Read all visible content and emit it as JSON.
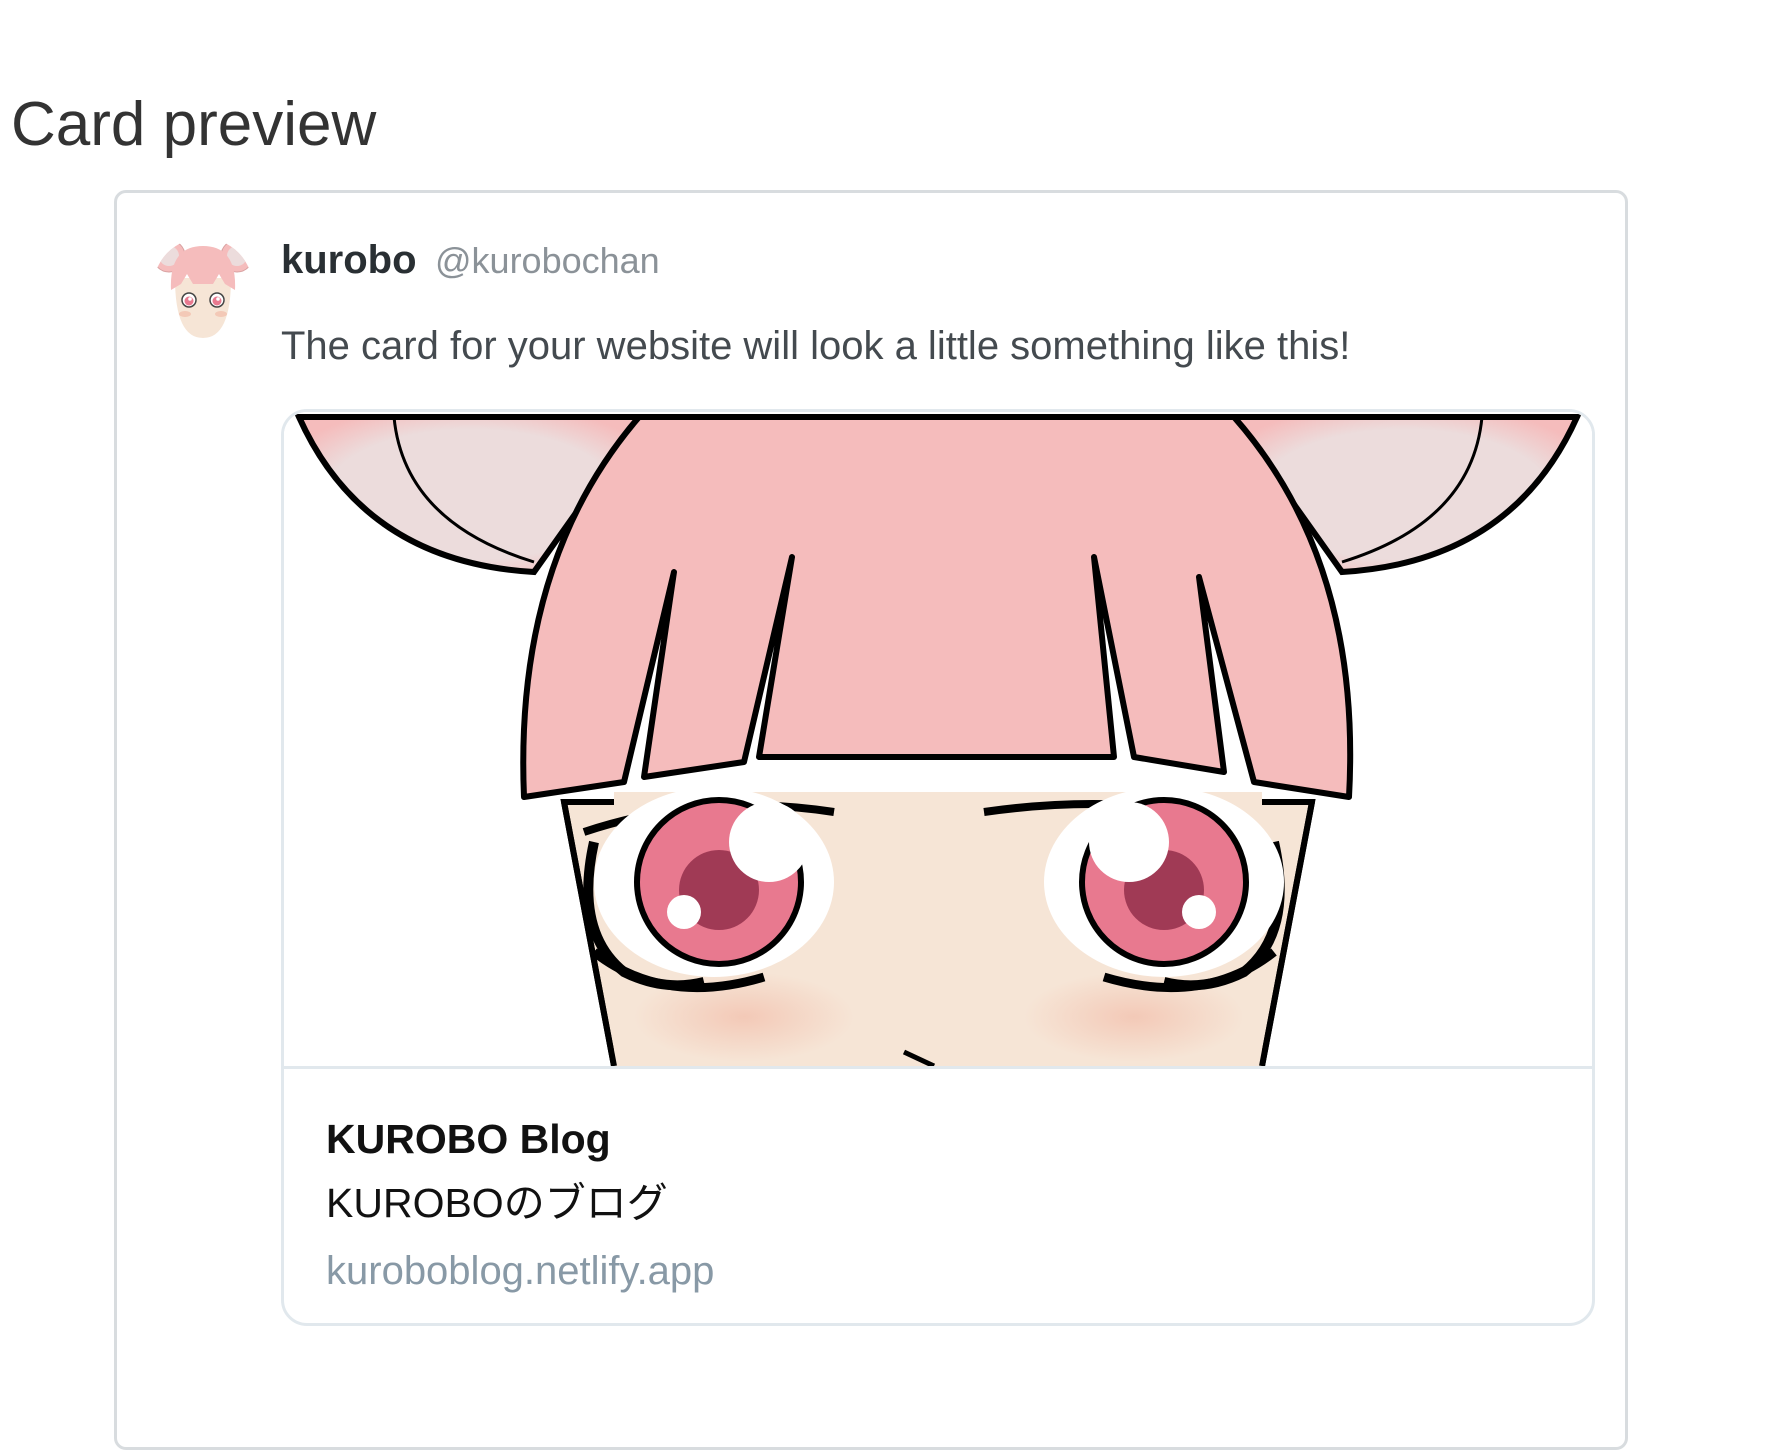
{
  "section": {
    "title": "Card preview"
  },
  "tweet": {
    "display_name": "kurobo",
    "handle": "@kurobochan",
    "text": "The card for your website will look a little something like this!"
  },
  "card": {
    "title": "KUROBO Blog",
    "description": "KUROBOのブログ",
    "url": "kuroboblog.netlify.app"
  },
  "colors": {
    "hair": "#f5bcbc",
    "skin": "#f6e5d6",
    "ear_inner": "#ecdcdc",
    "iris": "#e8798f",
    "blush": "#f3c9b7",
    "outline": "#000000"
  },
  "icons": {
    "avatar": "anime-girl-avatar-icon",
    "card_image": "anime-girl-illustration"
  }
}
